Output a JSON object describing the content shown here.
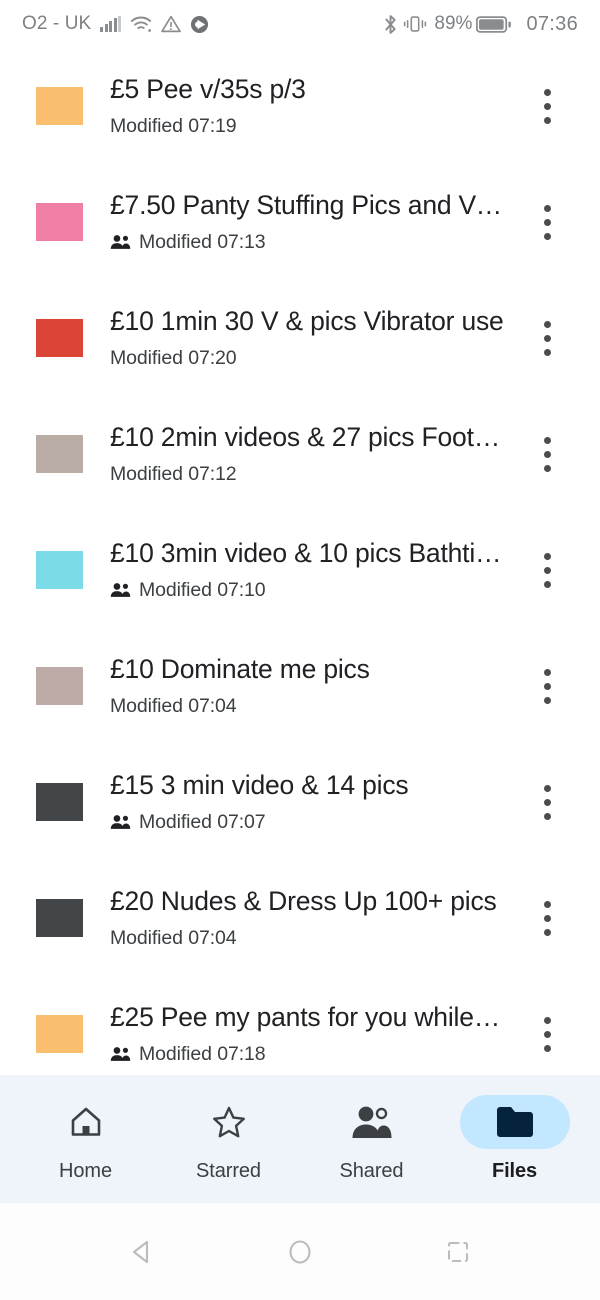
{
  "status_bar": {
    "carrier": "O2 - UK",
    "signal_icon": "signal-bars-icon",
    "wifi_icon": "wifi-icon",
    "warning_icon": "warning-triangle-icon",
    "app_icon": "circle-play-icon",
    "bluetooth_icon": "bluetooth-icon",
    "vibrate_icon": "vibrate-icon",
    "battery_percent": "89%",
    "battery_icon": "battery-icon",
    "time": "07:36"
  },
  "file_list": {
    "rows": [
      {
        "title": "£5 Pee v/35s p/3",
        "modified": "Modified 07:19",
        "shared": false,
        "color": "#f9be6e",
        "menu_icon": "overflow-menu-icon"
      },
      {
        "title": "£7.50 Panty Stuffing Pics and Vi…",
        "modified": "Modified 07:13",
        "shared": true,
        "color": "#f07fa6",
        "menu_icon": "overflow-menu-icon"
      },
      {
        "title": "£10 1min 30 V & pics Vibrator use",
        "modified": "Modified 07:20",
        "shared": false,
        "color": "#db4437",
        "menu_icon": "overflow-menu-icon"
      },
      {
        "title": "£10 2min videos & 27 pics Foot …",
        "modified": "Modified 07:12",
        "shared": false,
        "color": "#b9ada6",
        "menu_icon": "overflow-menu-icon"
      },
      {
        "title": "£10 3min video & 10 pics Bathti…",
        "modified": "Modified 07:10",
        "shared": true,
        "color": "#7bdce8",
        "menu_icon": "overflow-menu-icon"
      },
      {
        "title": "£10 Dominate me pics",
        "modified": "Modified 07:04",
        "shared": false,
        "color": "#bcaba6",
        "menu_icon": "overflow-menu-icon"
      },
      {
        "title": "£15 3 min video & 14 pics",
        "modified": "Modified 07:07",
        "shared": true,
        "color": "#434649",
        "menu_icon": "overflow-menu-icon"
      },
      {
        "title": "£20 Nudes & Dress Up 100+ pics",
        "modified": "Modified 07:04",
        "shared": false,
        "color": "#434649",
        "menu_icon": "overflow-menu-icon"
      },
      {
        "title": "£25 Pee my pants for you while t…",
        "modified": "Modified 07:18",
        "shared": true,
        "color": "#f9be6e",
        "menu_icon": "overflow-menu-icon"
      }
    ]
  },
  "bottom_nav": {
    "active_pill_color": "#c2e7ff",
    "background_color": "#eff3fa",
    "items": [
      {
        "label": "Home",
        "icon": "home-icon",
        "active": false
      },
      {
        "label": "Starred",
        "icon": "star-icon",
        "active": false
      },
      {
        "label": "Shared",
        "icon": "people-icon",
        "active": false
      },
      {
        "label": "Files",
        "icon": "folder-icon",
        "active": true
      }
    ]
  },
  "system_nav": {
    "back_icon": "back-triangle-icon",
    "home_icon": "home-circle-icon",
    "recents_icon": "recents-square-icon"
  }
}
